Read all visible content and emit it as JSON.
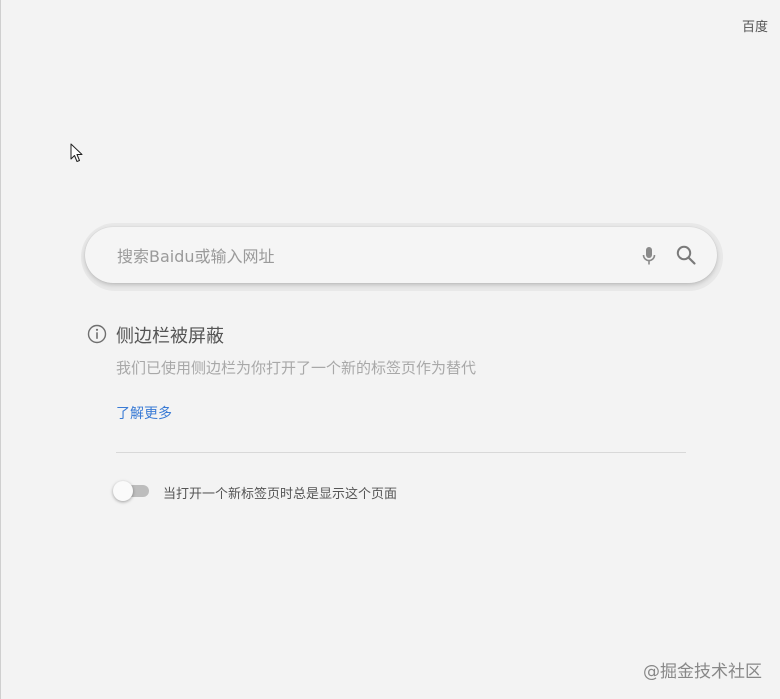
{
  "header": {
    "top_link": "百度"
  },
  "search": {
    "placeholder": "搜索Baidu或输入网址",
    "value": "",
    "mic_icon": "microphone-icon",
    "search_icon": "magnifier-icon"
  },
  "notice": {
    "icon": "info-icon",
    "title": "侧边栏被屏蔽",
    "description": "我们已使用侧边栏为你打开了一个新的标签页作为替代",
    "learn_more": "了解更多"
  },
  "setting": {
    "toggle_on": false,
    "label": "当打开一个新标签页时总是显示这个页面"
  },
  "watermark": {
    "text": "@掘金技术社区"
  },
  "colors": {
    "background": "#f3f3f3",
    "link": "#3a7bd5",
    "muted_text": "#a8a8a8"
  }
}
